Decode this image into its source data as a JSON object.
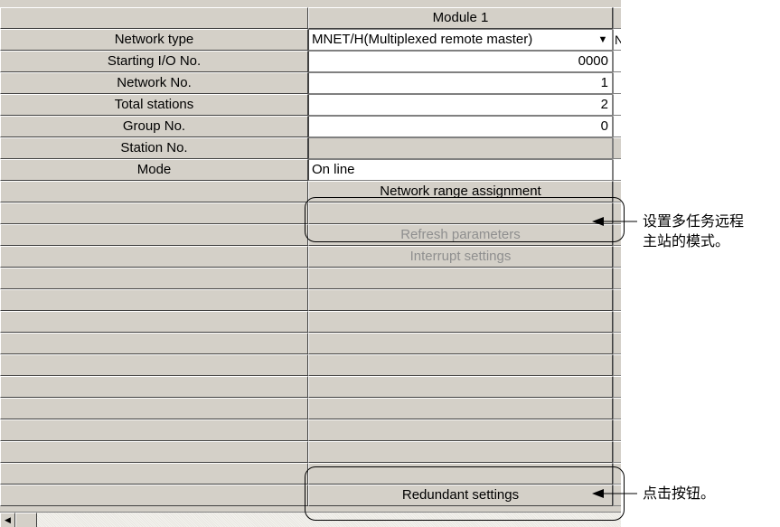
{
  "table": {
    "column_header": "Module 1",
    "rows": [
      {
        "label": "Network type",
        "value": "MNET/H(Multiplexed remote master)",
        "edge": "N"
      },
      {
        "label": "Starting I/O No.",
        "value": "0000"
      },
      {
        "label": "Network No.",
        "value": "1"
      },
      {
        "label": "Total stations",
        "value": "2"
      },
      {
        "label": "Group No.",
        "value": "0"
      },
      {
        "label": "Station No.",
        "value": ""
      },
      {
        "label": "Mode",
        "value": "On line"
      }
    ],
    "buttons": {
      "network_range": "Network range assignment",
      "refresh": "Refresh parameters",
      "interrupt": "Interrupt settings",
      "redundant": "Redundant settings"
    }
  },
  "annotations": {
    "mode_line1": "设置多任务远程",
    "mode_line2": "主站的模式。",
    "redundant": "点击按钮。"
  },
  "icons": {
    "dropdown": "chevron-down-icon",
    "scroll_left": "scroll-left-icon"
  }
}
